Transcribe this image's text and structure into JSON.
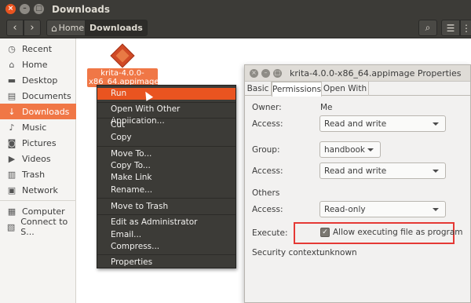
{
  "window": {
    "title": "Downloads",
    "controls": {
      "close": "×",
      "minimize": "–",
      "maximize": "□"
    }
  },
  "toolbar": {
    "back_icon": "‹",
    "forward_icon": "›",
    "breadcrumb": [
      {
        "label": "Home",
        "icon": "home-icon"
      },
      {
        "label": "Downloads"
      }
    ],
    "search_icon": "⌕",
    "view_icon": "☰",
    "menu_icon": "⋮"
  },
  "sidebar": {
    "items": [
      {
        "label": "Recent",
        "icon": "clock-icon",
        "glyph": "◷"
      },
      {
        "label": "Home",
        "icon": "home-icon",
        "glyph": "⌂"
      },
      {
        "label": "Desktop",
        "icon": "desktop-icon",
        "glyph": "▬"
      },
      {
        "label": "Documents",
        "icon": "document-icon",
        "glyph": "▤"
      },
      {
        "label": "Downloads",
        "icon": "download-icon",
        "glyph": "↓",
        "active": true
      },
      {
        "label": "Music",
        "icon": "music-icon",
        "glyph": "♪"
      },
      {
        "label": "Pictures",
        "icon": "camera-icon",
        "glyph": "◙"
      },
      {
        "label": "Videos",
        "icon": "video-icon",
        "glyph": "▶"
      },
      {
        "label": "Trash",
        "icon": "trash-icon",
        "glyph": "▥"
      },
      {
        "label": "Network",
        "icon": "network-icon",
        "glyph": "▣"
      },
      {
        "label": "Computer",
        "icon": "computer-icon",
        "glyph": "▦"
      },
      {
        "label": "Connect to S...",
        "icon": "server-icon",
        "glyph": "▧"
      }
    ]
  },
  "file": {
    "label": "krita-4.0.0-x86_64.appimage",
    "icon": "appimage-file-icon"
  },
  "context_menu": {
    "items": [
      {
        "label": "Run",
        "highlighted": true
      },
      {
        "label": "Open With Other Application..."
      },
      {
        "label": "Cut"
      },
      {
        "label": "Copy"
      },
      {
        "label": "Move To..."
      },
      {
        "label": "Copy To..."
      },
      {
        "label": "Make Link"
      },
      {
        "label": "Rename..."
      },
      {
        "label": "Move to Trash"
      },
      {
        "label": "Edit as Administrator"
      },
      {
        "label": "Email..."
      },
      {
        "label": "Compress..."
      },
      {
        "label": "Properties"
      }
    ]
  },
  "properties": {
    "title": "krita-4.0.0-x86_64.appimage Properties",
    "tabs": [
      {
        "label": "Basic"
      },
      {
        "label": "Permissions",
        "active": true
      },
      {
        "label": "Open With"
      }
    ],
    "owner_label": "Owner:",
    "owner_value": "Me",
    "owner_access_label": "Access:",
    "owner_access_value": "Read and write",
    "group_label": "Group:",
    "group_value": "handbook",
    "group_access_label": "Access:",
    "group_access_value": "Read and write",
    "others_label": "Others",
    "others_access_label": "Access:",
    "others_access_value": "Read-only",
    "execute_label": "Execute:",
    "execute_checkbox_label": "Allow executing file as program",
    "execute_checked": true,
    "security_label": "Security context:",
    "security_value": "unknown"
  },
  "colors": {
    "accent": "#e95420",
    "selection": "#f07746",
    "titlebar": "#3c3b37",
    "highlight_box": "#e53935"
  }
}
